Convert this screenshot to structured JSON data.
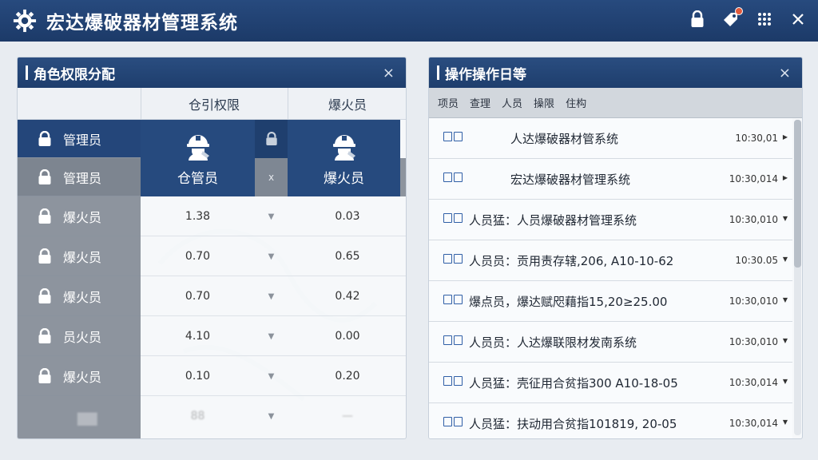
{
  "app": {
    "title": "宏达爆破器材管理系统"
  },
  "titlebar_icons": [
    "lock-icon",
    "tag-notification-icon",
    "grid-menu-icon",
    "close-icon"
  ],
  "role_panel": {
    "title": "角色权限分配",
    "close": "×",
    "headers": [
      "仓引权限",
      "爆火员"
    ],
    "highlight": {
      "left_label": "仓管员",
      "right_label": "爆火员",
      "mid_symbol": "x"
    },
    "roles": [
      "管理员",
      "管理员",
      "爆火员",
      "爆火员",
      "爆火员",
      "员火员",
      "爆火员",
      "▇▇"
    ],
    "rows": [
      {
        "left": "1.38",
        "right": "0.03"
      },
      {
        "left": "0.70",
        "right": "0.65"
      },
      {
        "left": "0.70",
        "right": "0.42"
      },
      {
        "left": "4.10",
        "right": "0.00"
      },
      {
        "left": "0.10",
        "right": "0.20"
      },
      {
        "left": "88",
        "right": "—"
      }
    ]
  },
  "log_panel": {
    "title": "操作操作日等",
    "close": "×",
    "tabs": [
      "项员",
      "查理",
      "人员",
      "操限",
      "住构"
    ],
    "entries": [
      {
        "msg": "人达爆破器材管系统",
        "time": "10:30,01"
      },
      {
        "msg": "宏达爆破器材管理系统",
        "time": "10:30,014"
      },
      {
        "msg": "人员猛：人员爆破器材管理系统",
        "time": "10:30,010"
      },
      {
        "msg": "人员员：贡用责存辖,206, A10-10-62",
        "time": "10:30.05"
      },
      {
        "msg": "爆点员，爆达赋咫藉指15,20≥25.00",
        "time": "10:30,010"
      },
      {
        "msg": "人员员：人达爆联限材发南系统",
        "time": "10:30,010"
      },
      {
        "msg": "人员猛：壳征用合贫指300 A10-18-05",
        "time": "10:30,014"
      },
      {
        "msg": "人员猛：扶动用合贫指101819, 20-05",
        "time": "10:30,014"
      }
    ]
  },
  "colors": {
    "primary": "#24467a",
    "grey": "#7d8590",
    "background": "#e8ecf1"
  }
}
